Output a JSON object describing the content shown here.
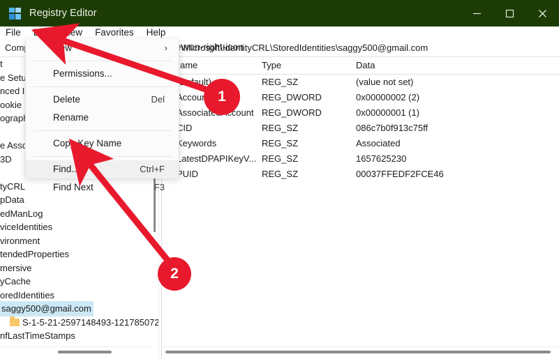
{
  "window": {
    "title": "Registry Editor",
    "icon": "registry-icon",
    "titlebar_color": "#1c3b05",
    "controls": [
      {
        "name": "minimize",
        "glyph": "minimize-icon"
      },
      {
        "name": "maximize",
        "glyph": "maximize-icon"
      },
      {
        "name": "close",
        "glyph": "close-icon"
      }
    ]
  },
  "menubar": {
    "items": [
      {
        "label": "File"
      },
      {
        "label": "Edit"
      },
      {
        "label": "View"
      },
      {
        "label": "Favorites"
      },
      {
        "label": "Help"
      }
    ]
  },
  "address": {
    "left_label": "Comp",
    "chevron": "chevron-right-icon",
    "path": "\\Microsoft\\IdentityCRL\\StoredIdentities\\saggy500@gmail.com"
  },
  "edit_menu": {
    "items": [
      {
        "label": "New",
        "accel": "",
        "submenu": "›",
        "hover": false
      },
      {
        "separator": true
      },
      {
        "label": "Permissions...",
        "accel": "",
        "hover": false
      },
      {
        "separator": true
      },
      {
        "label": "Delete",
        "accel": "Del",
        "hover": false
      },
      {
        "label": "Rename",
        "accel": "",
        "hover": false
      },
      {
        "separator": true
      },
      {
        "label": "Copy Key Name",
        "accel": "",
        "hover": false
      },
      {
        "separator": true
      },
      {
        "label": "Find...",
        "accel": "Ctrl+F",
        "hover": true
      },
      {
        "label": "Find Next",
        "accel": "F3",
        "hover": false
      }
    ]
  },
  "tree": {
    "items": [
      {
        "label": "t",
        "selected": false,
        "folder": false
      },
      {
        "label": "e Setup",
        "selected": false,
        "folder": false
      },
      {
        "label": "nced II",
        "selected": false,
        "folder": false
      },
      {
        "label": "ookie",
        "selected": false,
        "folder": false
      },
      {
        "label": "ograph",
        "selected": false,
        "folder": false
      },
      {
        "label": "",
        "selected": false,
        "folder": false
      },
      {
        "label": "e Assc",
        "selected": false,
        "folder": false
      },
      {
        "label": "3D",
        "selected": false,
        "folder": false
      },
      {
        "label": "",
        "selected": false,
        "folder": false
      },
      {
        "label": "tyCRL",
        "selected": false,
        "folder": false
      },
      {
        "label": "pData",
        "selected": false,
        "folder": false
      },
      {
        "label": "edManLog",
        "selected": false,
        "folder": false
      },
      {
        "label": "viceIdentities",
        "selected": false,
        "folder": false
      },
      {
        "label": "vironment",
        "selected": false,
        "folder": false
      },
      {
        "label": "tendedProperties",
        "selected": false,
        "folder": false
      },
      {
        "label": "mersive",
        "selected": false,
        "folder": false
      },
      {
        "label": "yCache",
        "selected": false,
        "folder": false
      },
      {
        "label": "oredIdentities",
        "selected": false,
        "folder": false
      },
      {
        "label": "saggy500@gmail.com",
        "selected": true,
        "folder": false
      },
      {
        "label": "S-1-5-21-2597148493-121785072",
        "selected": false,
        "folder": true
      },
      {
        "label": "nfLastTimeStamps",
        "selected": false,
        "folder": false
      }
    ]
  },
  "list": {
    "columns": [
      "ame",
      "Type",
      "Data"
    ],
    "rows": [
      {
        "name": "(Default)",
        "type": "REG_SZ",
        "data": "(value not set)"
      },
      {
        "name": "AccountCount",
        "type": "REG_DWORD",
        "data": "0x00000002 (2)"
      },
      {
        "name": "AssociatedAccount",
        "type": "REG_DWORD",
        "data": "0x00000001 (1)"
      },
      {
        "name": "CID",
        "type": "REG_SZ",
        "data": "086c7b0f913c75ff"
      },
      {
        "name": "Keywords",
        "type": "REG_SZ",
        "data": "Associated"
      },
      {
        "name": "LatestDPAPIKeyV...",
        "type": "REG_SZ",
        "data": "1657625230"
      },
      {
        "name": "PUID",
        "type": "REG_SZ",
        "data": "00037FFEDF2FCE46"
      }
    ]
  },
  "annotations": {
    "accent_color": "#e8192c",
    "markers": [
      {
        "label": "1",
        "points_to": "edit-menu"
      },
      {
        "label": "2",
        "points_to": "find-menu-item"
      }
    ]
  }
}
